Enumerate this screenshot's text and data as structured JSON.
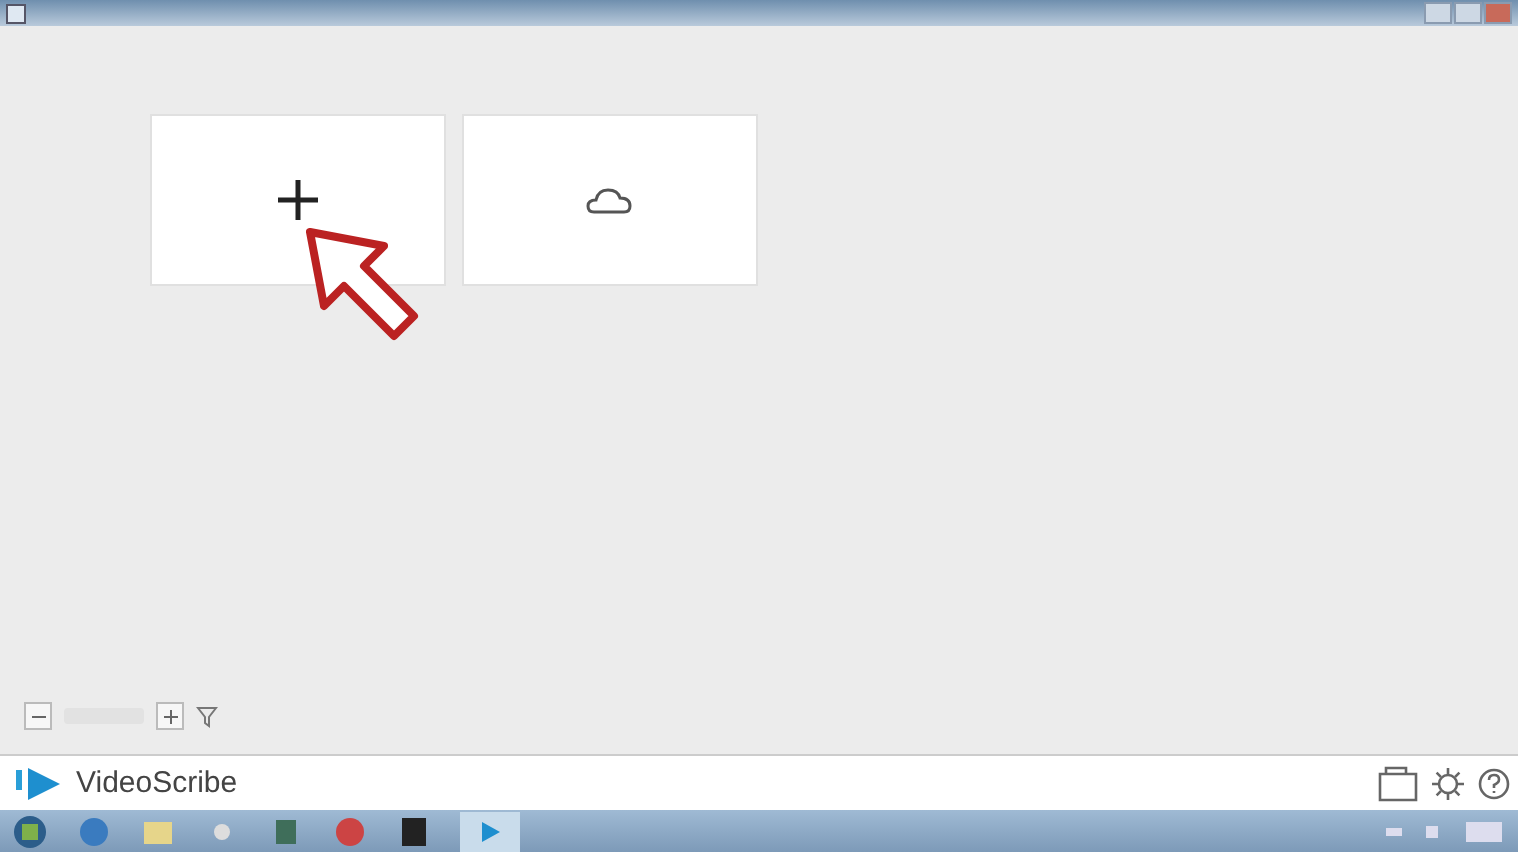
{
  "cards": [
    {
      "kind": "new"
    },
    {
      "kind": "cloud"
    }
  ],
  "bottom_bar": {
    "app_name": "VideoScribe"
  }
}
